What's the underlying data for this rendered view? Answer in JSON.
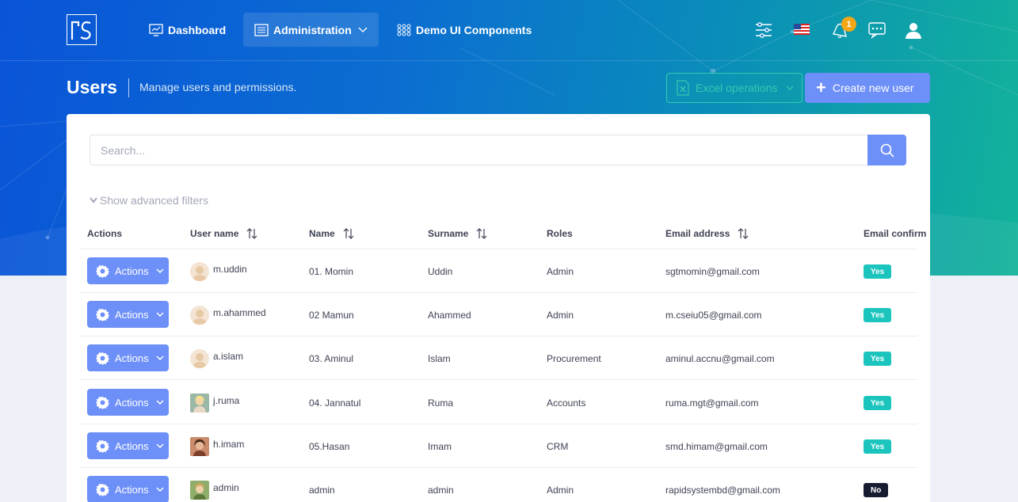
{
  "nav": {
    "dashboard": "Dashboard",
    "administration": "Administration",
    "demo": "Demo UI Components",
    "notification_count": "1"
  },
  "header": {
    "title": "Users",
    "subtitle": "Manage users and permissions.",
    "excel_label": "Excel operations",
    "create_label": "Create new user"
  },
  "search": {
    "placeholder": "Search...",
    "advanced_filters": "Show advanced filters"
  },
  "table": {
    "columns": [
      "Actions",
      "User name",
      "Name",
      "Surname",
      "Roles",
      "Email address",
      "Email confirm"
    ],
    "action_label": "Actions",
    "rows": [
      {
        "username": "m.uddin",
        "name": "01. Momin",
        "surname": "Uddin",
        "role": "Admin",
        "email": "sgtmomin@gmail.com",
        "confirmed": "Yes"
      },
      {
        "username": "m.ahammed",
        "name": "02 Mamun",
        "surname": "Ahammed",
        "role": "Admin",
        "email": "m.cseiu05@gmail.com",
        "confirmed": "Yes"
      },
      {
        "username": "a.islam",
        "name": "03. Aminul",
        "surname": "Islam",
        "role": "Procurement",
        "email": "aminul.accnu@gmail.com",
        "confirmed": "Yes"
      },
      {
        "username": "j.ruma",
        "name": "04. Jannatul",
        "surname": "Ruma",
        "role": "Accounts",
        "email": "ruma.mgt@gmail.com",
        "confirmed": "Yes"
      },
      {
        "username": "h.imam",
        "name": "05.Hasan",
        "surname": "Imam",
        "role": "CRM",
        "email": "smd.himam@gmail.com",
        "confirmed": "Yes"
      },
      {
        "username": "admin",
        "name": "admin",
        "surname": "admin",
        "role": "Admin",
        "email": "rapidsystembd@gmail.com",
        "confirmed": "No"
      }
    ]
  },
  "colors": {
    "primary": "#6d8ff8",
    "success": "#1bc5bd",
    "dark": "#181c32",
    "warning": "#f4a615"
  }
}
